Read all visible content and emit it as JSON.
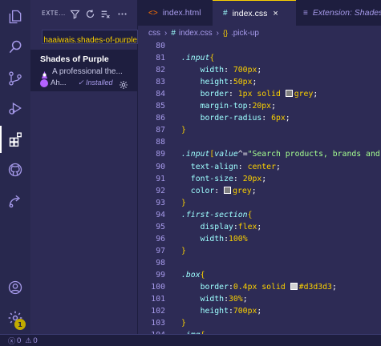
{
  "sidebar": {
    "title": "EXTE...",
    "search_value": "ehaaiwais.shades-of-purple",
    "extension": {
      "name": "Shades of Purple",
      "description": "A professional the...",
      "author": "Ah...",
      "installed": "✓ Installed"
    }
  },
  "tabs": [
    {
      "icon": "<>",
      "label": "index.html"
    },
    {
      "icon": "#",
      "label": "index.css",
      "close": "×"
    },
    {
      "icon": "≡",
      "label": "Extension: Shades o"
    }
  ],
  "breadcrumb": {
    "folder": "css",
    "file": "index.css",
    "symbol": ".pick-up"
  },
  "code_lines": [
    {
      "n": "80",
      "t": ""
    },
    {
      "n": "81",
      "t": "<span class=\"sel\">.input</span><span class=\"brace\">{</span>"
    },
    {
      "n": "82",
      "t": "    <span class=\"prop\">width</span><span class=\"col\">: </span><span class=\"val\">700px</span><span class=\"col\">;</span>"
    },
    {
      "n": "83",
      "t": "    <span class=\"prop\">height</span><span class=\"col\">:</span><span class=\"val\">50px</span><span class=\"col\">;</span>"
    },
    {
      "n": "84",
      "t": "    <span class=\"prop\">border</span><span class=\"col\">: </span><span class=\"val\">1px solid </span><span class=\"swatch\" style=\"background:#808080\"></span><span class=\"val\">grey</span><span class=\"col\">;</span>"
    },
    {
      "n": "85",
      "t": "    <span class=\"prop\">margin-top</span><span class=\"col\">:</span><span class=\"val\">20px</span><span class=\"col\">;</span>"
    },
    {
      "n": "86",
      "t": "    <span class=\"prop\">border-radius</span><span class=\"col\">: </span><span class=\"val\">6px</span><span class=\"col\">;</span>"
    },
    {
      "n": "87",
      "t": "<span class=\"brace\">}</span>"
    },
    {
      "n": "88",
      "t": ""
    },
    {
      "n": "89",
      "t": "<span class=\"sel\">.input</span><span class=\"brace\">[</span><span class=\"sel\">value</span><span class=\"col\">^=</span><span class=\"str\">\"Search products, brands and more\"</span><span class=\"brace\">]{</span>"
    },
    {
      "n": "90",
      "t": "  <span class=\"prop\">text-align</span><span class=\"col\">: </span><span class=\"val\">center</span><span class=\"col\">;</span>"
    },
    {
      "n": "91",
      "t": "  <span class=\"prop\">font-size</span><span class=\"col\">: </span><span class=\"val\">20px</span><span class=\"col\">;</span>"
    },
    {
      "n": "92",
      "t": "  <span class=\"prop\">color</span><span class=\"col\">: </span><span class=\"swatch\" style=\"background:#808080\"></span><span class=\"val\">grey</span><span class=\"col\">;</span>"
    },
    {
      "n": "93",
      "t": "<span class=\"brace\">}</span>"
    },
    {
      "n": "94",
      "t": "<span class=\"sel\">.first-section</span><span class=\"brace\">{</span>"
    },
    {
      "n": "95",
      "t": "    <span class=\"prop\">display</span><span class=\"col\">:</span><span class=\"val\">flex</span><span class=\"col\">;</span>"
    },
    {
      "n": "96",
      "t": "    <span class=\"prop\">width</span><span class=\"col\">:</span><span class=\"val\">100%</span>"
    },
    {
      "n": "97",
      "t": "<span class=\"brace\">}</span>"
    },
    {
      "n": "98",
      "t": ""
    },
    {
      "n": "99",
      "t": "<span class=\"sel\">.box</span><span class=\"brace\">{</span>"
    },
    {
      "n": "100",
      "t": "    <span class=\"prop\">border</span><span class=\"col\">:</span><span class=\"val\">0.4px solid </span><span class=\"swatch\" style=\"background:#d3d3d3\"></span><span class=\"val\">#d3d3d3</span><span class=\"col\">;</span>"
    },
    {
      "n": "101",
      "t": "    <span class=\"prop\">width</span><span class=\"col\">:</span><span class=\"val\">30%</span><span class=\"col\">;</span>"
    },
    {
      "n": "102",
      "t": "    <span class=\"prop\">height</span><span class=\"col\">:</span><span class=\"val\">700px</span><span class=\"col\">;</span>"
    },
    {
      "n": "103",
      "t": "<span class=\"brace\">}</span>"
    },
    {
      "n": "104",
      "t": "<span class=\"sel\">.img</span><span class=\"brace\">{</span>"
    }
  ],
  "statusbar": {
    "errors": "0",
    "warnings": "0"
  },
  "badges": {
    "manage": "1"
  },
  "colors": {
    "background": "#2d2b55",
    "dark": "#1e1e3f",
    "accent": "#fad000",
    "selector": "#9effff",
    "string": "#a5ff90"
  }
}
